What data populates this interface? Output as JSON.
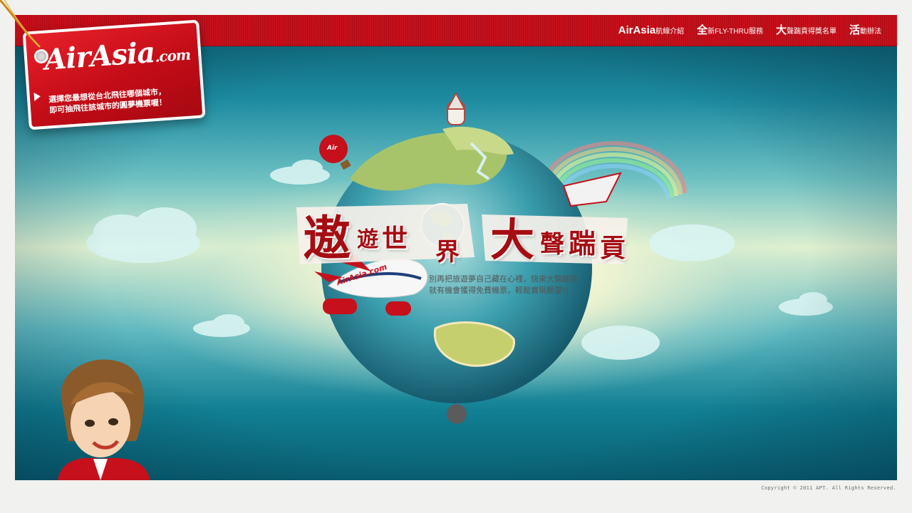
{
  "brand": {
    "logo_main": "AirAsia",
    "logo_suffix": ".com",
    "tag_line_1": "選擇您最想從台北飛往哪個城市，",
    "tag_line_2": "即可抽飛往該城市的圓夢機票喔！"
  },
  "nav": [
    {
      "lead": "AirAsia",
      "rest": "航線介紹"
    },
    {
      "lead": "全",
      "rest": "新FLY-THRU服務"
    },
    {
      "lead": "大",
      "rest": "聲踹貢得獎名單"
    },
    {
      "lead": "活",
      "rest": "動辦法"
    }
  ],
  "hero": {
    "title_chars": [
      "遨",
      "遊",
      "世",
      "界",
      "大",
      "聲",
      "踹",
      "貢"
    ],
    "subtitle_1": "別再把旅遊夢自己藏在心裡，快來大聲踹貢",
    "subtitle_2": "就有機會獲得免費機票，輕鬆實現願望!!",
    "balloon_text": "Air",
    "plane_text": "AirAsia.com"
  },
  "footer": {
    "copyright": "Copyright © 2011 APT. All Rights Reserved."
  },
  "colors": {
    "brand_red": "#c6101b",
    "background": "#f1f1ef",
    "sea_teal": "#1c8aa0"
  }
}
